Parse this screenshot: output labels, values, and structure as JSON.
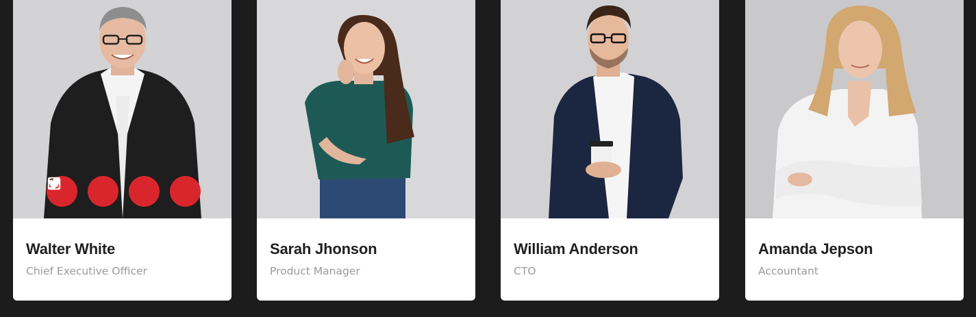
{
  "team": [
    {
      "name": "Walter White",
      "role": "Chief Executive Officer"
    },
    {
      "name": "Sarah Jhonson",
      "role": "Product Manager"
    },
    {
      "name": "William Anderson",
      "role": "CTO"
    },
    {
      "name": "Amanda Jepson",
      "role": "Accountant"
    }
  ],
  "socials": [
    {
      "icon": "twitter-icon"
    },
    {
      "icon": "facebook-icon"
    },
    {
      "icon": "instagram-icon"
    },
    {
      "icon": "linkedin-icon"
    }
  ],
  "colors": {
    "page_background": "#1c1c1c",
    "card_background": "#ffffff",
    "accent": "#d9262c",
    "name_text": "#1f1f1f",
    "role_text": "#9a9a9a"
  }
}
